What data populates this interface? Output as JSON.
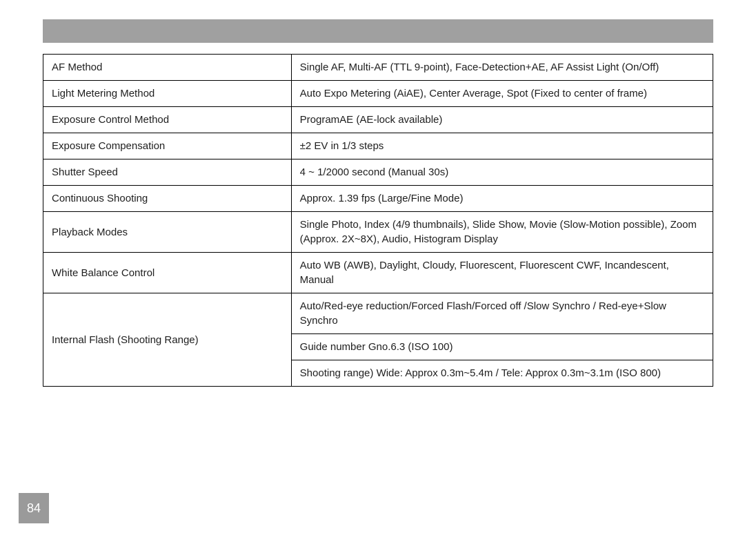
{
  "page_number": "84",
  "spec_rows": [
    {
      "label": "AF Method",
      "value": "Single AF, Multi-AF (TTL 9-point), Face-Detection+AE, AF Assist Light (On/Off)",
      "label_rowspan": 1
    },
    {
      "label": "Light Metering Method",
      "value": "Auto Expo Metering (AiAE), Center Average, Spot (Fixed to center of frame)",
      "label_rowspan": 1
    },
    {
      "label": "Exposure Control Method",
      "value": "ProgramAE (AE-lock available)",
      "label_rowspan": 1
    },
    {
      "label": "Exposure Compensation",
      "value": "±2 EV in 1/3 steps",
      "label_rowspan": 1
    },
    {
      "label": "Shutter Speed",
      "value": "4 ~ 1/2000 second (Manual 30s)",
      "label_rowspan": 1
    },
    {
      "label": "Continuous Shooting",
      "value": "Approx. 1.39 fps (Large/Fine Mode)",
      "label_rowspan": 1
    },
    {
      "label": "Playback Modes",
      "value": "Single Photo, Index (4/9 thumbnails), Slide Show, Movie (Slow-Motion possible), Zoom (Approx. 2X~8X), Audio, Histogram Display",
      "label_rowspan": 1
    },
    {
      "label": "White Balance Control",
      "value": "Auto WB (AWB), Daylight, Cloudy, Fluorescent, Fluorescent CWF, Incandescent, Manual",
      "label_rowspan": 1
    },
    {
      "label": "Internal Flash (Shooting Range)",
      "value": "Auto/Red-eye reduction/Forced Flash/Forced off /Slow Synchro / Red-eye+Slow Synchro",
      "label_rowspan": 3
    },
    {
      "label": null,
      "value": "Guide number Gno.6.3 (ISO 100)",
      "label_rowspan": 0
    },
    {
      "label": null,
      "value": "Shooting range) Wide: Approx 0.3m~5.4m / Tele: Approx 0.3m~3.1m (ISO 800)",
      "label_rowspan": 0
    }
  ]
}
